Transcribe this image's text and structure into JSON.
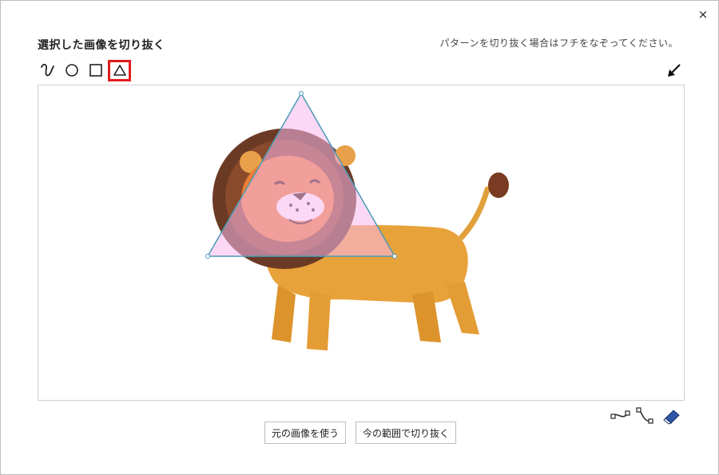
{
  "dialog": {
    "close_label": "×",
    "title": "選択した画像を切り抜く",
    "hint": "パターンを切り抜く場合はフチをなぞってください。"
  },
  "tools": {
    "freehand": "freehand-icon",
    "circle": "circle-icon",
    "square": "square-icon",
    "triangle": "triangle-icon",
    "active": "triangle"
  },
  "actions": {
    "use_original": "元の画像を使う",
    "crop_current": "今の範囲で切り抜く"
  },
  "colors": {
    "active_tool_border": "#e21c1c",
    "selection_fill": "#f7b8ec",
    "selection_stroke": "#4a9bb8"
  }
}
